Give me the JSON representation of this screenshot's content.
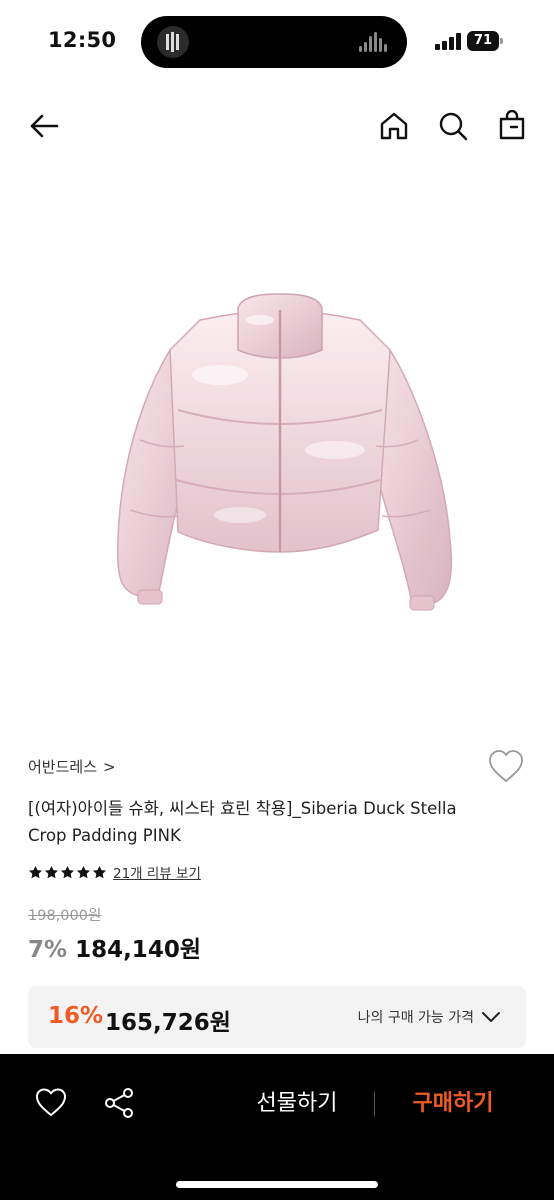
{
  "status_bar": {
    "time": "12:50",
    "battery": "71"
  },
  "nav": {
    "back_icon": "arrow-left-icon",
    "home_icon": "home-icon",
    "search_icon": "search-icon",
    "bag_icon": "shopping-bag-icon"
  },
  "product": {
    "brand": "어반드레스",
    "brand_chevron": ">",
    "title": "[(여자)아이들 슈화, 씨스타 효린 착용]_Siberia Duck Stella Crop Padding PINK",
    "stars": 5,
    "review_link": "21개 리뷰 보기",
    "original_price": "198,000원",
    "discount_pct": "7%",
    "sale_price": "184,140원",
    "image_desc_color": "#f1d9df"
  },
  "my_price": {
    "pct": "16%",
    "price": "165,726원",
    "label": "나의 구매 가능 가격"
  },
  "bottom_bar": {
    "gift_label": "선물하기",
    "buy_label": "구매하기",
    "accent": "#f05a23"
  }
}
